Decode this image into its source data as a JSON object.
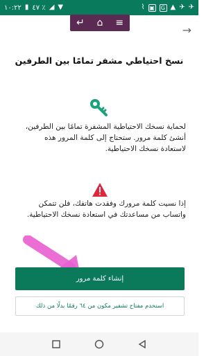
{
  "status_bar": {
    "time": "١٠:٢٢",
    "battery": "٤٧ ٪",
    "icons": [
      "signal-icon",
      "wifi-icon",
      "cast-icon",
      "twitter-icon",
      "twitter-icon",
      "image-icon",
      "translate-icon",
      "chart-icon"
    ]
  },
  "overlay_nav": {
    "icons": [
      "enter-icon",
      "home-icon",
      "menu-icon"
    ]
  },
  "header": {
    "forward_icon": "arrow-right-icon",
    "title": "نسخ احتياطي مشفر تمامًا بين الطرفين"
  },
  "content": {
    "key_icon": "key-icon",
    "paragraph_1": "لحماية نسخك الاحتياطية المشفرة تمامًا بين الطرفين، أنشئ كلمة مرور. ستحتاج إلى كلمة المرور هذه لاستعادة نسخك الاحتياطية.",
    "warning_icon": "warning-icon",
    "paragraph_2": "إذا نسيت كلمة مرورك وفقدت هاتفك، فلن تتمكن واتساب من مساعدتك في استعادة نسخك الاحتياطية."
  },
  "actions": {
    "primary_label": "إنشاء كلمة مرور",
    "secondary_label": "استخدم مفتاح تشفير مكون من ٦٤ رقمًا بدلًا من ذلك"
  },
  "colors": {
    "primary": "#0b7a5a",
    "warning": "#e0243e",
    "key": "#1aa37a",
    "overlay_nav": "#5b2a52",
    "highlight_arrow": "#e85fd0"
  },
  "system_nav": [
    "recents-icon",
    "home-circle-icon",
    "back-icon"
  ]
}
